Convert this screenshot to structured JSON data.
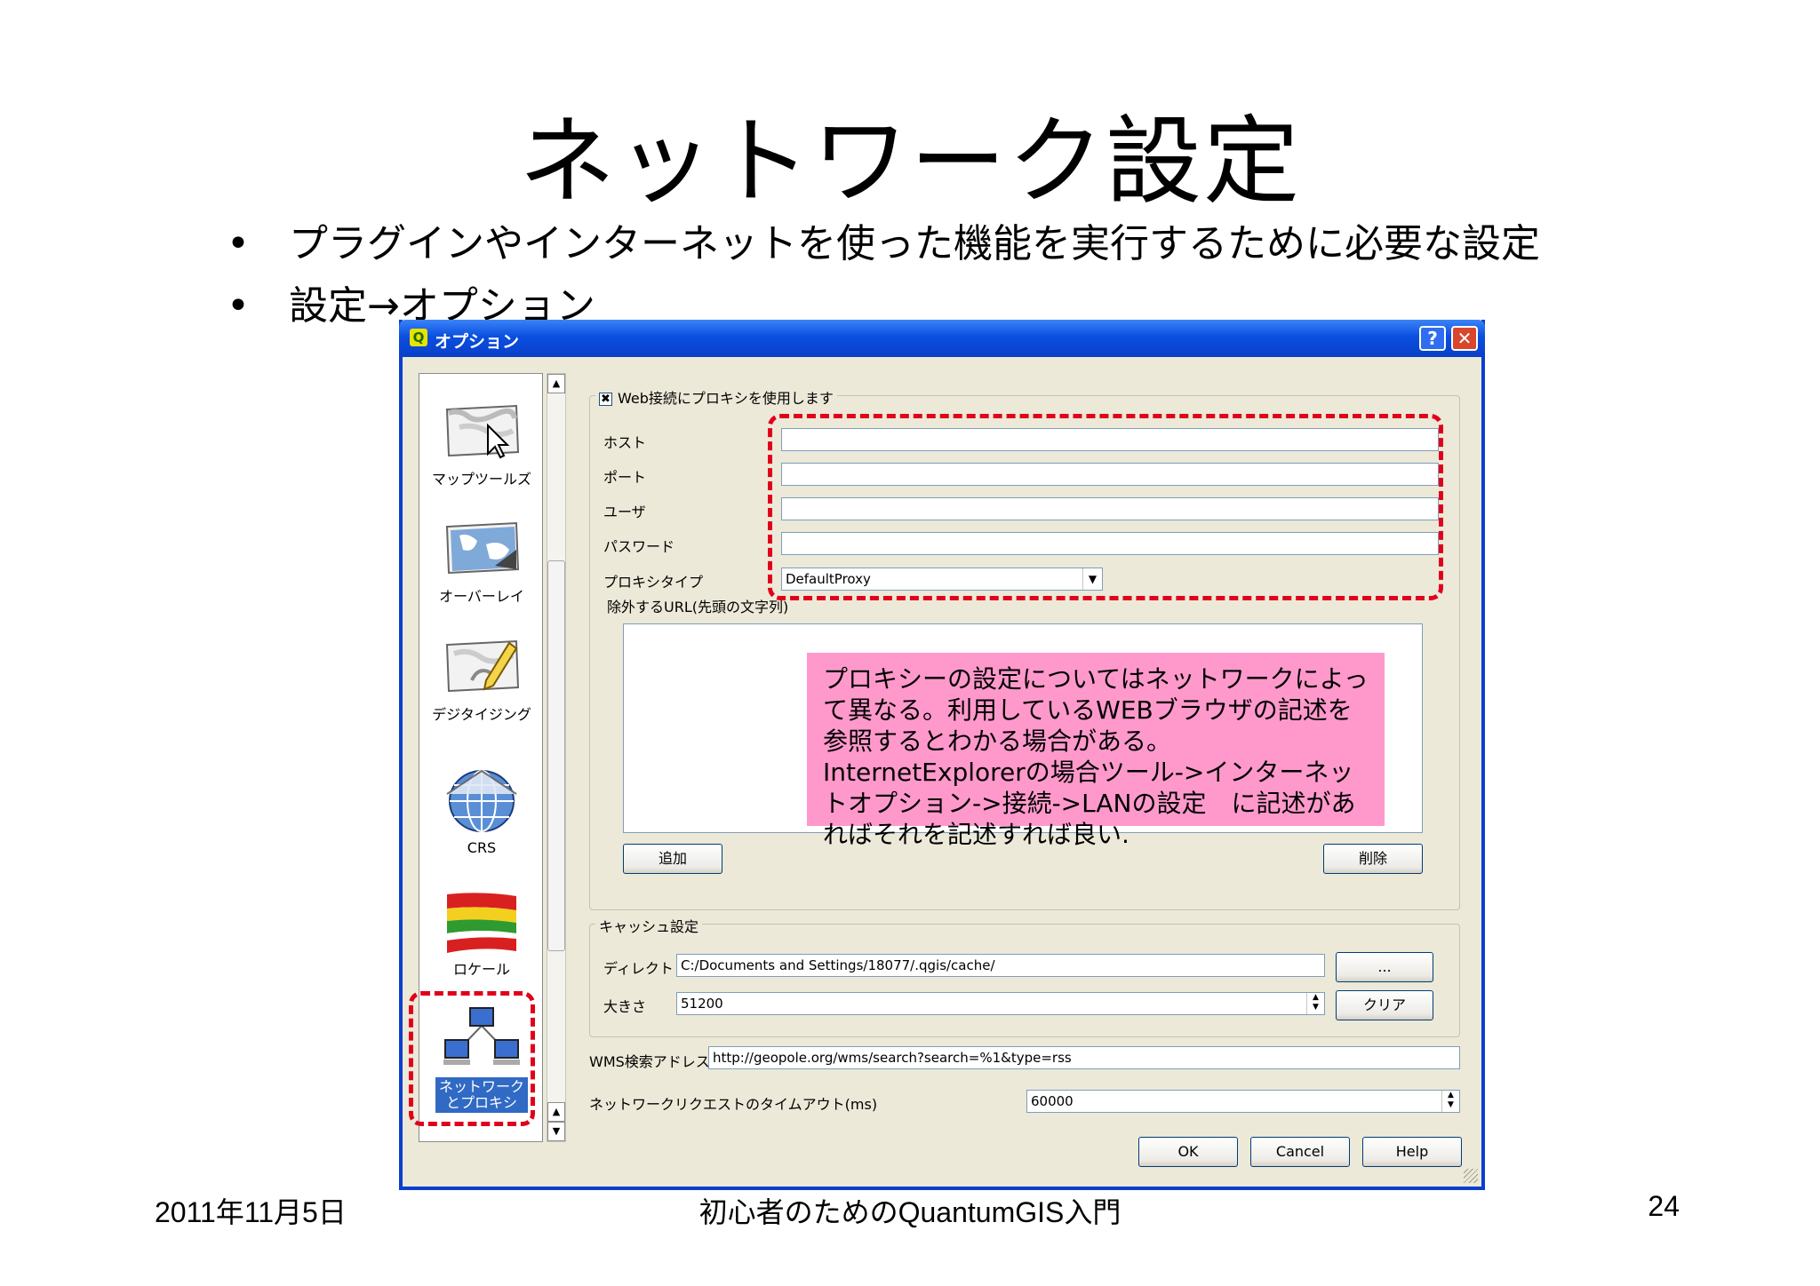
{
  "slide": {
    "title": "ネットワーク設定",
    "bullets": [
      "プラグインやインターネットを使った機能を実行するために必要な設定",
      "設定→オプション"
    ],
    "bullet_symbol": "•",
    "footer_date": "2011年11月5日",
    "footer_title": "初心者のためのQuantumGIS入門",
    "page_number": "24"
  },
  "dialog": {
    "title": "オプション",
    "help_glyph": "?",
    "close_glyph": "✕",
    "sidebar_items": [
      {
        "label": "マップツールズ",
        "icon": "map-cursor-icon"
      },
      {
        "label": "オーバーレイ",
        "icon": "map-overlay-icon"
      },
      {
        "label": "デジタイジング",
        "icon": "map-pencil-icon"
      },
      {
        "label": "CRS",
        "icon": "globe-icon"
      },
      {
        "label": "ロケール",
        "icon": "flag-icon"
      },
      {
        "label": "ネットワークとプロキシ",
        "icon": "network-icon"
      }
    ],
    "proxy": {
      "checkbox_label": "Web接続にプロキシを使用します",
      "checked_glyph": "✖",
      "host_label": "ホスト",
      "port_label": "ポート",
      "user_label": "ユーザ",
      "password_label": "パスワード",
      "type_label": "プロキシタイプ",
      "type_value": "DefaultProxy",
      "exclude_label": "除外するURL(先頭の文字列)",
      "add_button": "追加",
      "remove_button": "削除"
    },
    "cache": {
      "group_label": "キャッシュ設定",
      "dir_label": "ディレクトリ",
      "dir_value": "C:/Documents and Settings/18077/.qgis/cache/",
      "browse_button": "...",
      "size_label": "大きさ",
      "size_value": "51200",
      "clear_button": "クリア"
    },
    "wms_label": "WMS検索アドレス",
    "wms_value": "http://geopole.org/wms/search?search=%1&type=rss",
    "timeout_label": "ネットワークリクエストのタイムアウト(ms)",
    "timeout_value": "60000",
    "ok_button": "OK",
    "cancel_button": "Cancel",
    "help_button": "Help"
  },
  "callout": {
    "text": "プロキシーの設定についてはネットワークによって異なる。利用しているWEBブラウザの記述を参照するとわかる場合がある。InternetExplorerの場合ツール->インターネットオプション->接続->LANの設定　に記述があればそれを記述すれば良い."
  },
  "colors": {
    "highlight_dash": "#e0001b",
    "callout_bg": "#ff99cc",
    "xp_titlebar": "#0a4fe0",
    "selected_item": "#316ac5"
  }
}
